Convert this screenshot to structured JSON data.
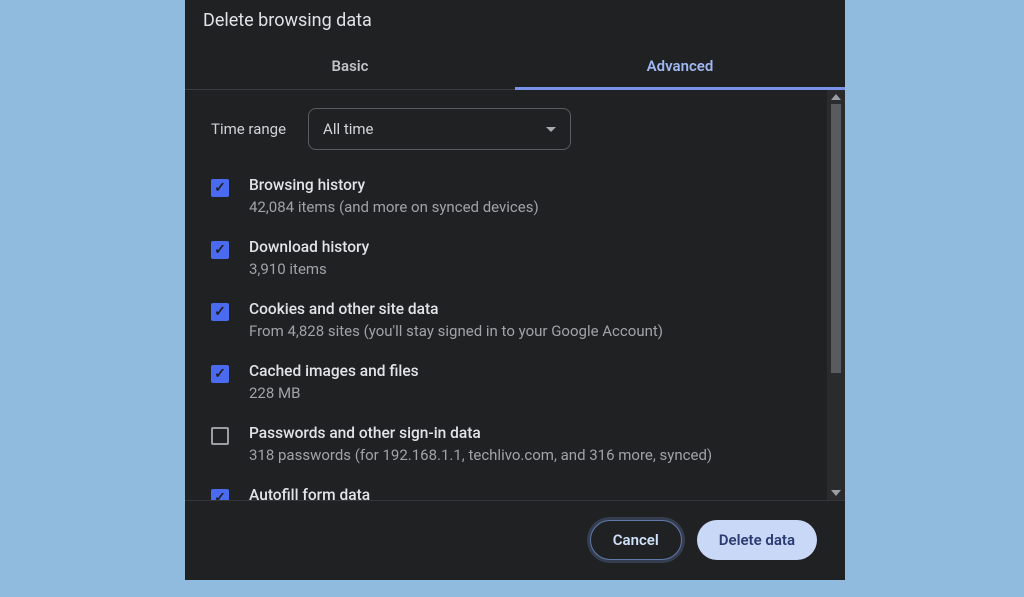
{
  "title": "Delete browsing data",
  "tabs": {
    "basic": "Basic",
    "advanced": "Advanced"
  },
  "time_range": {
    "label": "Time range",
    "value": "All time"
  },
  "items": [
    {
      "title": "Browsing history",
      "sub": "42,084 items (and more on synced devices)",
      "checked": true
    },
    {
      "title": "Download history",
      "sub": "3,910 items",
      "checked": true
    },
    {
      "title": "Cookies and other site data",
      "sub": "From 4,828 sites (you'll stay signed in to your Google Account)",
      "checked": true
    },
    {
      "title": "Cached images and files",
      "sub": "228 MB",
      "checked": true
    },
    {
      "title": "Passwords and other sign-in data",
      "sub": "318 passwords (for 192.168.1.1, techlivo.com, and 316 more, synced)",
      "checked": false
    },
    {
      "title": "Autofill form data",
      "sub": "",
      "checked": true
    }
  ],
  "buttons": {
    "cancel": "Cancel",
    "delete": "Delete data"
  }
}
